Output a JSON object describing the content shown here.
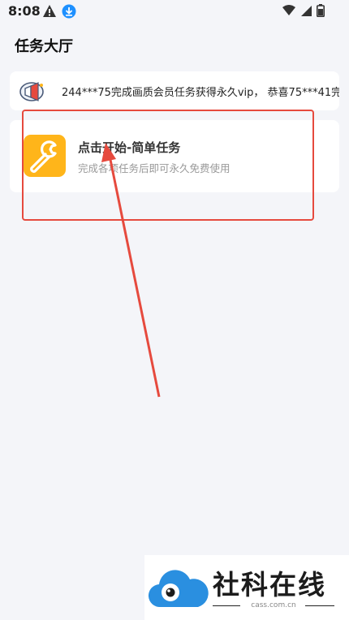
{
  "status_bar": {
    "time": "8:08",
    "left_icons": [
      "alert-icon",
      "download-icon"
    ],
    "right_icons": [
      "wifi-icon",
      "signal-icon",
      "battery-icon"
    ]
  },
  "page": {
    "title": "任务大厅"
  },
  "marquee": {
    "icon": "megaphone-icon",
    "text": "244***75完成画质会员任务获得永久vip， 恭喜75***41完成"
  },
  "task": {
    "icon": "wrench-icon",
    "title": "点击开始-简单任务",
    "subtitle": "完成各项任务后即可永久免费使用"
  },
  "annotation": {
    "color": "#e64a3e"
  },
  "watermark": {
    "brand": "社科在线",
    "domain": "cass.com.cn",
    "icon": "cloud-eye-logo-icon",
    "color": "#2a8fe0"
  },
  "colors": {
    "background": "#f4f5f9",
    "task_icon": "#ffb51a"
  }
}
